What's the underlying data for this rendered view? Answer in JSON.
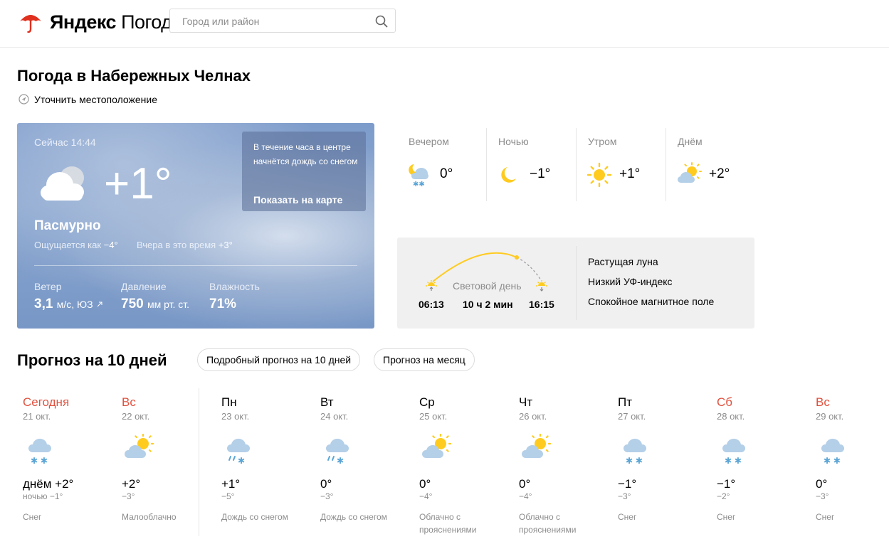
{
  "header": {
    "logo_ya": "Яндекс",
    "logo_rest": "Погода",
    "search_placeholder": "Город или район"
  },
  "page": {
    "title": "Погода в Набережных Челнах",
    "locate_label": "Уточнить местоположение"
  },
  "now": {
    "time": "Сейчас 14:44",
    "temp": "+1°",
    "condition": "Пасмурно",
    "feels_label": "Ощущается как",
    "feels_value": "−4°",
    "yesterday_label": "Вчера в это время",
    "yesterday_value": "+3°",
    "wind_label": "Ветер",
    "wind_value": "3,1",
    "wind_unit": "м/с, ЮЗ",
    "pressure_label": "Давление",
    "pressure_value": "750",
    "pressure_unit": "мм рт. ст.",
    "humidity_label": "Влажность",
    "humidity_value": "71%",
    "alert_text": "В течение часа в центре начнётся дождь со снегом",
    "alert_link": "Показать на карте"
  },
  "parts": [
    {
      "label": "Вечером",
      "temp": "0°",
      "icon": "cloud-moon-snow-icon"
    },
    {
      "label": "Ночью",
      "temp": "−1°",
      "icon": "moon-icon"
    },
    {
      "label": "Утром",
      "temp": "+1°",
      "icon": "sun-icon"
    },
    {
      "label": "Днём",
      "temp": "+2°",
      "icon": "sun-cloud-icon"
    }
  ],
  "sun": {
    "label": "Световой день",
    "sunrise": "06:13",
    "length": "10 ч 2 мин",
    "sunset": "16:15",
    "facts": [
      "Растущая луна",
      "Низкий УФ-индекс",
      "Спокойное магнитное поле"
    ]
  },
  "forecast": {
    "title": "Прогноз на 10 дней",
    "btn_detailed": "Подробный прогноз на 10 дней",
    "btn_month": "Прогноз на месяц",
    "days": [
      {
        "name": "Сегодня",
        "date": "21 окт.",
        "max": "днём +2°",
        "min": "ночью −1°",
        "cond": "Снег",
        "icon": "snow-cloud-icon",
        "red": true
      },
      {
        "name": "Вс",
        "date": "22 окт.",
        "max": "+2°",
        "min": "−3°",
        "cond": "Малооблачно",
        "icon": "sun-cloud-icon",
        "red": true
      },
      {
        "name": "Пн",
        "date": "23 окт.",
        "max": "+1°",
        "min": "−5°",
        "cond": "Дождь со снегом",
        "icon": "rain-snow-cloud-icon",
        "red": false
      },
      {
        "name": "Вт",
        "date": "24 окт.",
        "max": "0°",
        "min": "−3°",
        "cond": "Дождь со снегом",
        "icon": "rain-snow-cloud-icon",
        "red": false
      },
      {
        "name": "Ср",
        "date": "25 окт.",
        "max": "0°",
        "min": "−4°",
        "cond": "Облачно с прояснениями",
        "icon": "sun-cloud-icon",
        "red": false
      },
      {
        "name": "Чт",
        "date": "26 окт.",
        "max": "0°",
        "min": "−4°",
        "cond": "Облачно с прояснениями",
        "icon": "sun-cloud-icon",
        "red": false
      },
      {
        "name": "Пт",
        "date": "27 окт.",
        "max": "−1°",
        "min": "−3°",
        "cond": "Снег",
        "icon": "snow-cloud-icon",
        "red": false
      },
      {
        "name": "Сб",
        "date": "28 окт.",
        "max": "−1°",
        "min": "−2°",
        "cond": "Снег",
        "icon": "snow-cloud-icon",
        "red": true
      },
      {
        "name": "Вс",
        "date": "29 окт.",
        "max": "0°",
        "min": "−3°",
        "cond": "Снег",
        "icon": "snow-cloud-icon",
        "red": true
      }
    ]
  },
  "colors": {
    "accent_red": "#e0523f",
    "sun_yellow": "#ffcb1f",
    "cloud_blue": "#aecbe6",
    "snow_blue": "#5ba5d6"
  }
}
